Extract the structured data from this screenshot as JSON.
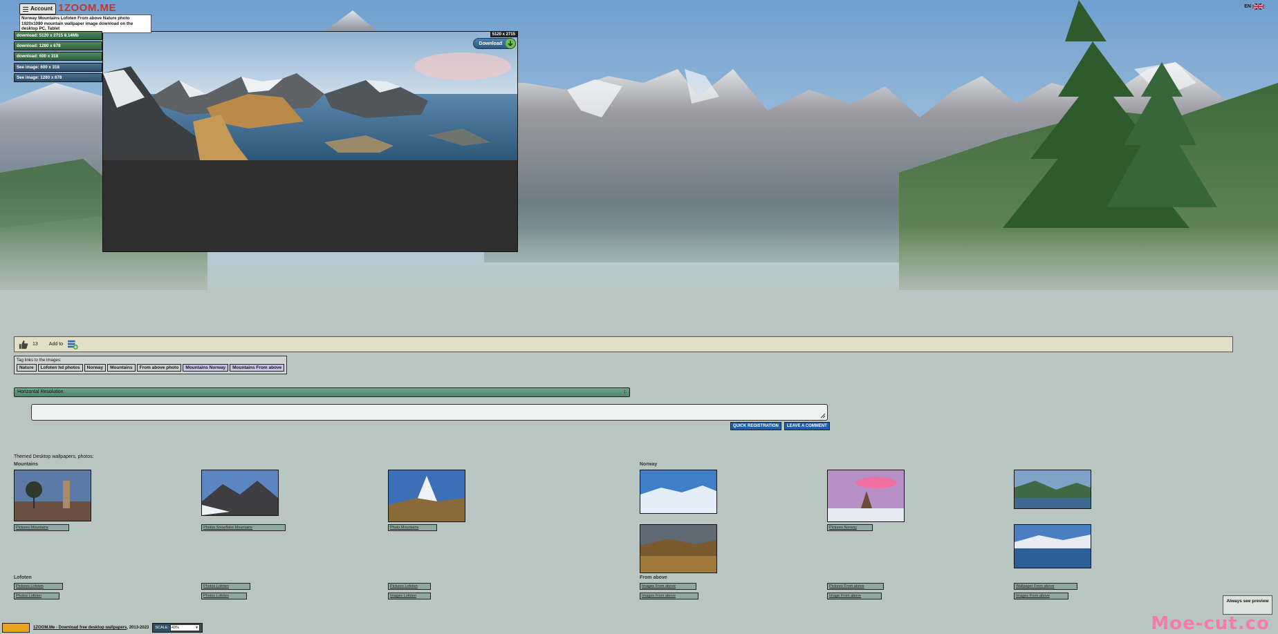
{
  "header": {
    "account_label": "Account",
    "logo": "1ZOOM.ME",
    "page_title": "Norway Mountains Lofoten From above Nature photo 1920x1080 mountain wallpaper image download on the desktop PC, Tablet",
    "lang": "EN"
  },
  "downloads": {
    "items": [
      "download: 5120 x 2715 8.14Mb",
      "download: 1280 x 678",
      "download: 600 x 318"
    ],
    "see": [
      "See image: 600 x 318",
      "See image: 1280 x 678"
    ]
  },
  "preview": {
    "resolution": "5120 x 2715",
    "download_label": "Download"
  },
  "likebar": {
    "likes": "13",
    "add_to": "Add to"
  },
  "tags": {
    "label": "Tag links to the images:",
    "items": [
      "Nature",
      "Lofoten hd photos",
      "Norway",
      "Mountains",
      "From above photo"
    ],
    "combo": [
      "Mountains Norway",
      "Mountains From above"
    ]
  },
  "resolution_select": {
    "label": "Horizontal Resolution:"
  },
  "comment": {
    "quick_registration": "QUICK REGISTRATION",
    "leave_comment": "LEAVE A COMMENT"
  },
  "themed": {
    "label": "Themed Desktop wallpapers, photos:",
    "categories": {
      "mountains": "Mountains",
      "norway": "Norway",
      "lofoten": "Lofoten",
      "from_above": "From above"
    },
    "mountain_links": [
      "Pictures Mountains",
      "Photos Snowflake Mountains",
      "Photo Mountains"
    ],
    "norway_links": [
      "Pictures Norway"
    ],
    "lofoten_links": [
      "Pictures Lofoten",
      "Photos Lofoten",
      "Pictures Lofoten",
      "Photos Lofoten",
      "Photos Lofoten",
      "Images Lofoten"
    ],
    "from_above_links": [
      "Images From above",
      "Pictures From above",
      "Wallpaper From above",
      "Images From above",
      "Image From above",
      "Images From above"
    ]
  },
  "footer": {
    "link_text": "1ZOOM.Me - Download free desktop wallpapers",
    "years": ", 2013-2023",
    "scale_label": "SCALE:",
    "scale_value": "43%"
  },
  "always_preview": "Always see preview",
  "watermark": "Moe-cut.co"
}
